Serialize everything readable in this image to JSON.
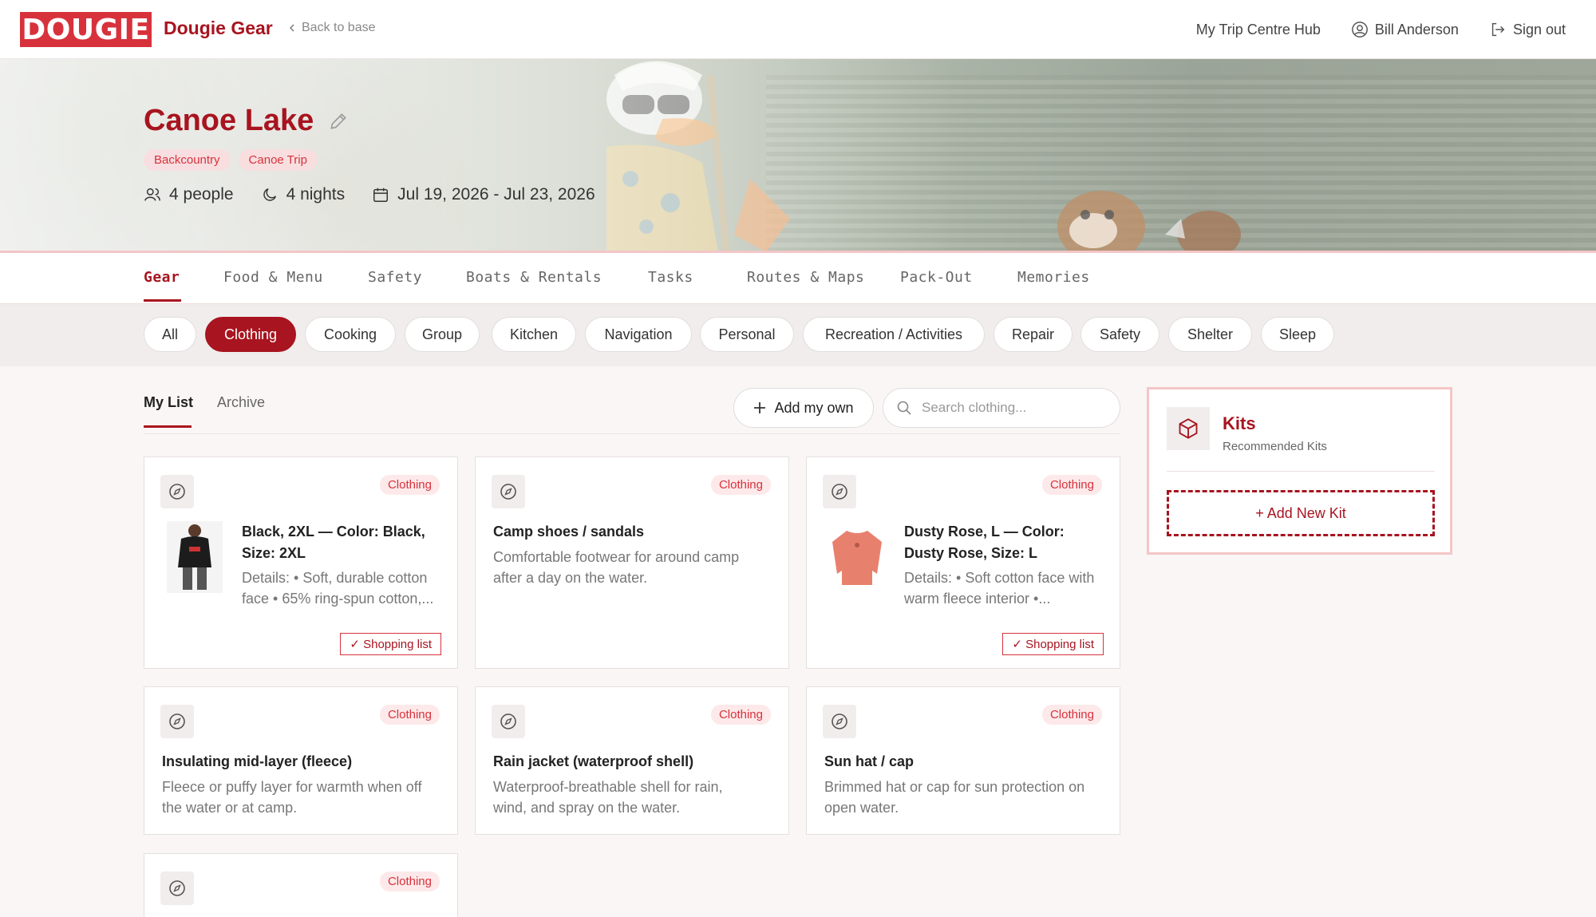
{
  "header": {
    "logo_text": "DOUGIE",
    "brand": "Dougie Gear",
    "back_label": "Back to base",
    "hub_label": "My Trip Centre Hub",
    "user_name": "Bill Anderson",
    "signout_label": "Sign out"
  },
  "trip": {
    "title": "Canoe Lake",
    "tags": [
      "Backcountry",
      "Canoe Trip"
    ],
    "people": "4 people",
    "nights": "4 nights",
    "dates": "Jul 19, 2026 - Jul 23, 2026"
  },
  "tabs": [
    "Gear",
    "Food & Menu",
    "Safety",
    "Boats & Rentals",
    "Tasks",
    "Routes & Maps",
    "Pack-Out",
    "Memories"
  ],
  "active_tab": "Gear",
  "categories": [
    "All",
    "Clothing",
    "Cooking",
    "Group",
    "Kitchen",
    "Navigation",
    "Personal",
    "Recreation / Activities",
    "Repair",
    "Safety",
    "Shelter",
    "Sleep"
  ],
  "active_category": "Clothing",
  "list_tabs": {
    "my_list": "My List",
    "archive": "Archive"
  },
  "add_label": "Add my own",
  "search_placeholder": "Search clothing...",
  "cards": [
    {
      "badge": "Clothing",
      "title": "Black, 2XL — Color: Black, Size: 2XL",
      "desc": "Details: • Soft, durable cotton face • 65% ring-spun cotton,...",
      "shopping": "✓ Shopping list",
      "thumb": "black-hoodie"
    },
    {
      "badge": "Clothing",
      "title": "Camp shoes / sandals",
      "desc": "Comfortable footwear for around camp after a day on the water."
    },
    {
      "badge": "Clothing",
      "title": "Dusty Rose, L — Color: Dusty Rose, Size: L",
      "desc": "Details: • Soft cotton face with warm fleece interior •...",
      "shopping": "✓ Shopping list",
      "thumb": "rose-sweatshirt"
    },
    {
      "badge": "Clothing",
      "title": "Insulating mid-layer (fleece)",
      "desc": "Fleece or puffy layer for warmth when off the water or at camp."
    },
    {
      "badge": "Clothing",
      "title": "Rain jacket (waterproof shell)",
      "desc": "Waterproof-breathable shell for rain, wind, and spray on the water."
    },
    {
      "badge": "Clothing",
      "title": "Sun hat / cap",
      "desc": "Brimmed hat or cap for sun protection on open water."
    },
    {
      "badge": "Clothing"
    }
  ],
  "kits": {
    "title": "Kits",
    "subtitle": "Recommended Kits",
    "add_label": "+ Add New Kit"
  },
  "colors": {
    "accent": "#a8141f",
    "brand_red": "#d7323c",
    "badge_bg": "#fde9ea"
  }
}
